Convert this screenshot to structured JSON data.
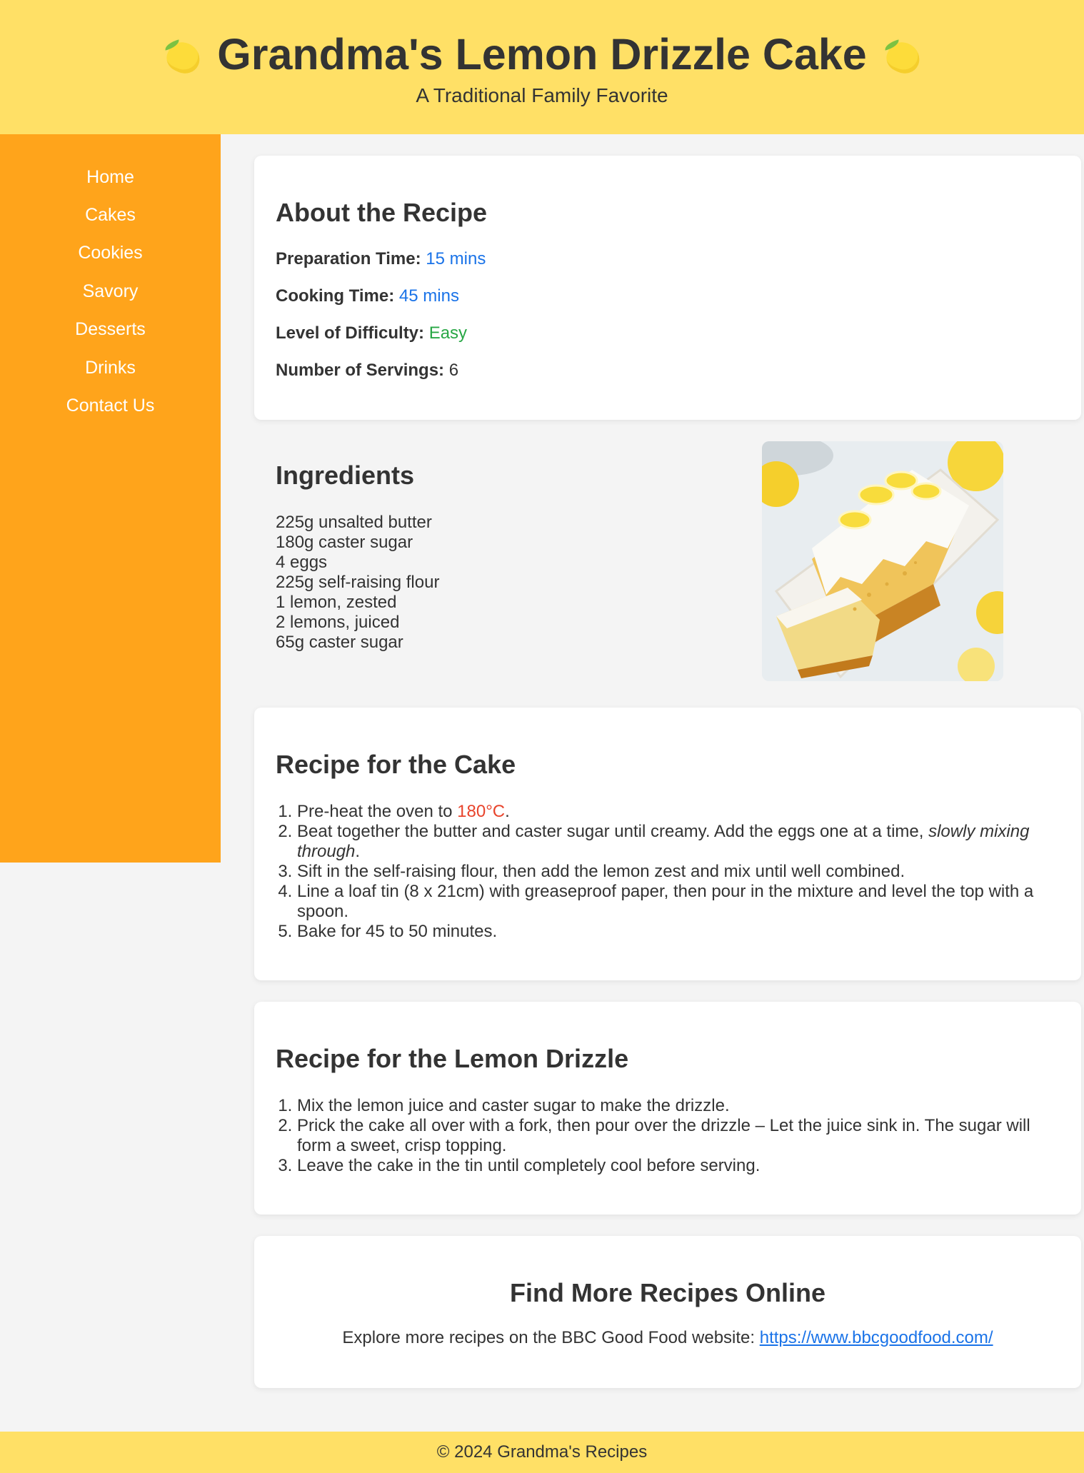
{
  "header": {
    "title": "Grandma's Lemon Drizzle Cake",
    "subtitle": "A Traditional Family Favorite",
    "left_icon": "lemon-icon",
    "right_icon": "lemon-icon"
  },
  "sidebar": {
    "items": [
      {
        "label": "Home"
      },
      {
        "label": "Cakes"
      },
      {
        "label": "Cookies"
      },
      {
        "label": "Savory"
      },
      {
        "label": "Desserts"
      },
      {
        "label": "Drinks"
      },
      {
        "label": "Contact Us"
      }
    ]
  },
  "about": {
    "heading": "About the Recipe",
    "prep_label": "Preparation Time:",
    "prep_value": "15 mins",
    "cook_label": "Cooking Time:",
    "cook_value": "45 mins",
    "difficulty_label": "Level of Difficulty:",
    "difficulty_value": "Easy",
    "servings_label": "Number of Servings:",
    "servings_value": "6"
  },
  "ingredients": {
    "heading": "Ingredients",
    "items": [
      "225g unsalted butter",
      "180g caster sugar",
      "4 eggs",
      "225g self-raising flour",
      "1 lemon, zested",
      "2 lemons, juiced",
      "65g caster sugar"
    ]
  },
  "cake_recipe": {
    "heading": "Recipe for the Cake",
    "step1_prefix": "Pre-heat the oven to ",
    "step1_temp": "180°C",
    "step1_suffix": ".",
    "step2_prefix": "Beat together the butter and caster sugar until creamy. Add the eggs one at a time, ",
    "step2_italic": "slowly mixing through",
    "step2_suffix": ".",
    "step3": "Sift in the self-raising flour, then add the lemon zest and mix until well combined.",
    "step4": "Line a loaf tin (8 x 21cm) with greaseproof paper, then pour in the mixture and level the top with a spoon.",
    "step5": "Bake for 45 to 50 minutes."
  },
  "drizzle_recipe": {
    "heading": "Recipe for the Lemon Drizzle",
    "steps": [
      "Mix the lemon juice and caster sugar to make the drizzle.",
      "Prick the cake all over with a fork, then pour over the drizzle – Let the juice sink in. The sugar will form a sweet, crisp topping.",
      "Leave the cake in the tin until completely cool before serving."
    ]
  },
  "more_recipes": {
    "heading": "Find More Recipes Online",
    "text": "Explore more recipes on the BBC Good Food website: ",
    "link": "https://www.bbcgoodfood.com/"
  },
  "footer": {
    "text": "© 2024 Grandma's Recipes"
  },
  "colors": {
    "header_bg": "#ffe066",
    "sidebar_bg": "#ffa41b",
    "time_value": "#1a73e8",
    "difficulty_value": "#28a745",
    "temperature": "#e8442c"
  }
}
